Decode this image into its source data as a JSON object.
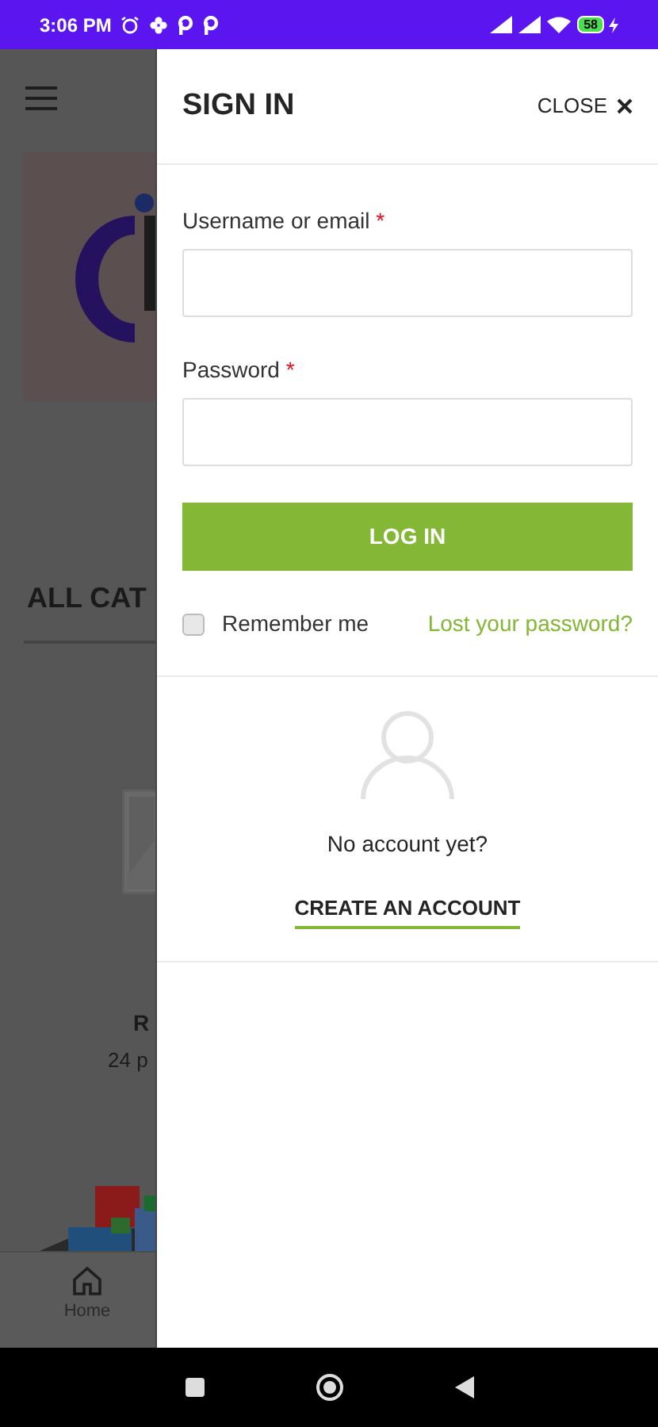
{
  "status_bar": {
    "time": "3:06 PM",
    "battery": "58"
  },
  "background_page": {
    "heading": "ALL CAT",
    "category_name": "R",
    "category_count": "24 p",
    "nav_label": "Home"
  },
  "drawer": {
    "title": "SIGN IN",
    "close_label": "CLOSE",
    "fields": [
      {
        "label": "Username or email",
        "required_mark": "*"
      },
      {
        "label": "Password",
        "required_mark": "*"
      }
    ],
    "login_button": "LOG IN",
    "remember": {
      "label": "Remember me",
      "checked": false
    },
    "lost_password": "Lost your password?",
    "no_account": "No account yet?",
    "create_account": "CREATE AN ACCOUNT"
  }
}
